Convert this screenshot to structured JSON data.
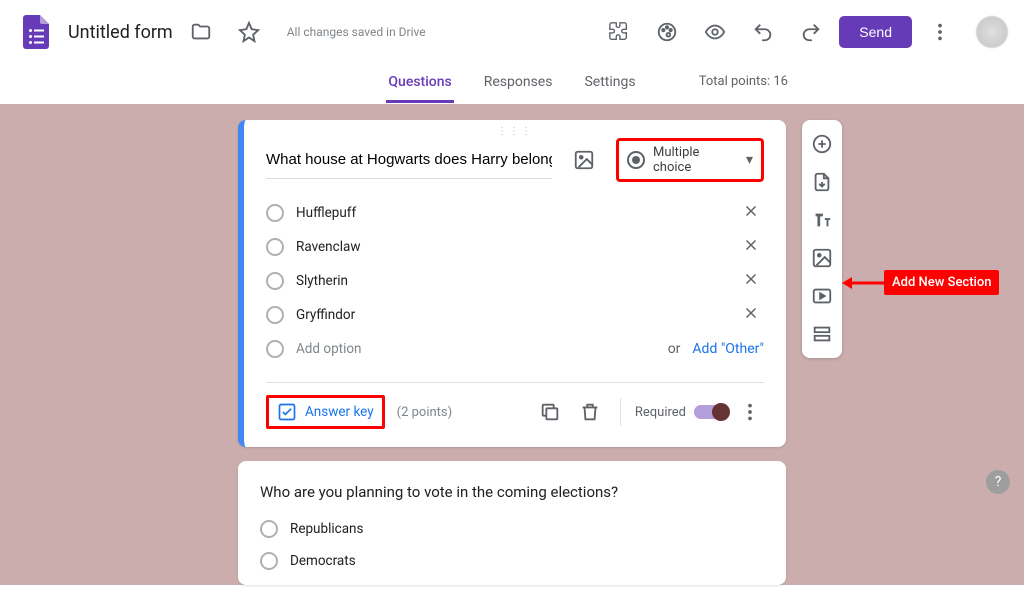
{
  "header": {
    "title": "Untitled form",
    "drive_status": "All changes saved in Drive",
    "send_label": "Send"
  },
  "tabs": {
    "questions": "Questions",
    "responses": "Responses",
    "settings": "Settings",
    "totals": "Total points: 16"
  },
  "question1": {
    "title": "What house at Hogwarts does Harry belong to?",
    "type_label": "Multiple choice",
    "options": [
      "Hufflepuff",
      "Ravenclaw",
      "Slytherin",
      "Gryffindor"
    ],
    "add_option": "Add option",
    "or_text": "or",
    "add_other": "Add \"Other\"",
    "answer_key": "Answer key",
    "points": "(2 points)",
    "required": "Required"
  },
  "question2": {
    "title": "Who are you planning to vote in the coming elections?",
    "options": [
      "Republicans",
      "Democrats"
    ]
  },
  "callout": "Add New Section"
}
